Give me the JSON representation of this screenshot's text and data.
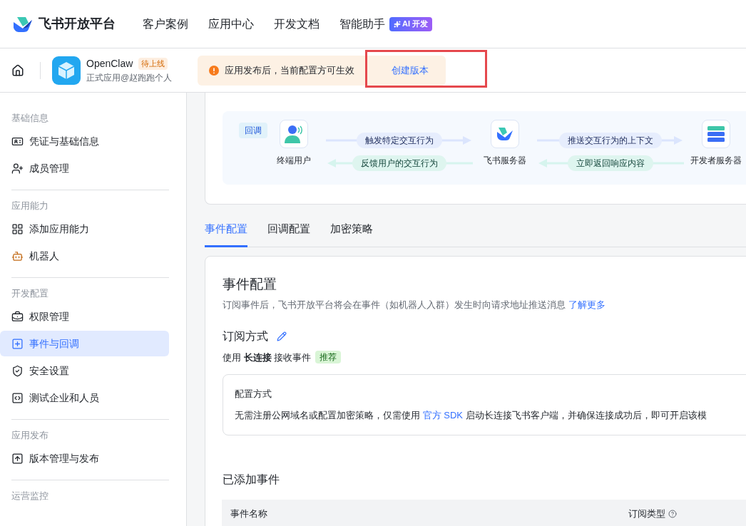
{
  "header": {
    "brand": "飞书开放平台",
    "nav": [
      {
        "label": "客户案例"
      },
      {
        "label": "应用中心"
      },
      {
        "label": "开发文档"
      },
      {
        "label": "智能助手",
        "badge": "AI 开发"
      }
    ]
  },
  "app_bar": {
    "app_name": "OpenClaw",
    "status_tag": "待上线",
    "app_sub": "正式应用@赵跑跑个人",
    "alert": {
      "text": "应用发布后，当前配置方可生效",
      "action": "创建版本"
    },
    "highlight": true
  },
  "sidebar": [
    {
      "title": "基础信息",
      "items": [
        {
          "label": "凭证与基础信息",
          "selected": false
        },
        {
          "label": "成员管理",
          "selected": false
        }
      ]
    },
    {
      "title": "应用能力",
      "items": [
        {
          "label": "添加应用能力",
          "selected": false
        },
        {
          "label": "机器人",
          "selected": false
        }
      ]
    },
    {
      "title": "开发配置",
      "items": [
        {
          "label": "权限管理",
          "selected": false
        },
        {
          "label": "事件与回调",
          "selected": true
        },
        {
          "label": "安全设置",
          "selected": false
        },
        {
          "label": "测试企业和人员",
          "selected": false
        }
      ]
    },
    {
      "title": "应用发布",
      "items": [
        {
          "label": "版本管理与发布",
          "selected": false
        }
      ]
    },
    {
      "title": "运营监控"
    }
  ],
  "diagram": {
    "tag": "回调",
    "nodes": [
      {
        "label": "终端用户"
      },
      {
        "label": "飞书服务器"
      },
      {
        "label": "开发者服务器"
      }
    ],
    "links": [
      {
        "forward": "触发特定交互行为",
        "backward": "反馈用户的交互行为"
      },
      {
        "forward": "推送交互行为的上下文",
        "backward": "立即返回响应内容"
      }
    ]
  },
  "tabs": [
    {
      "label": "事件配置",
      "selected": true
    },
    {
      "label": "回调配置",
      "selected": false
    },
    {
      "label": "加密策略",
      "selected": false
    }
  ],
  "event_config": {
    "title": "事件配置",
    "description": "订阅事件后，飞书开放平台将会在事件（如机器人入群）发生时向请求地址推送消息",
    "learn_more": "了解更多",
    "subscribe_title": "订阅方式",
    "method": "使用 **长连接** 接收事件",
    "method_tag": "推荐",
    "config_box": {
      "title": "配置方式",
      "text_before": "无需注册公网域名或配置加密策略，仅需使用",
      "link": "官方 SDK",
      "text_after": "启动长连接飞书客户端，并确保连接成功后，即可开启该模"
    },
    "added_title": "已添加事件",
    "table": {
      "columns": [
        "事件名称",
        "订阅类型"
      ]
    }
  }
}
